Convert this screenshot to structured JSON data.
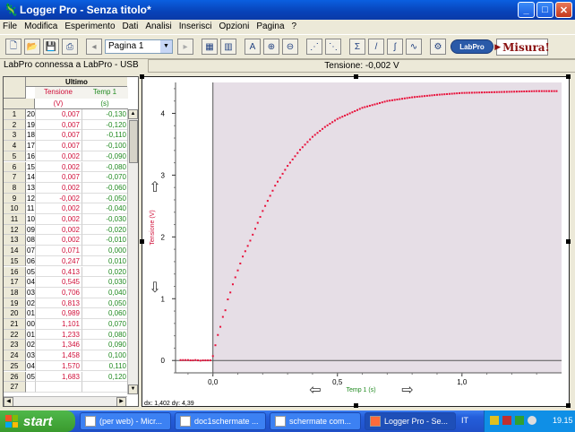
{
  "window": {
    "title": "Logger Pro - Senza titolo*"
  },
  "menu": [
    "File",
    "Modifica",
    "Esperimento",
    "Dati",
    "Analisi",
    "Inserisci",
    "Opzioni",
    "Pagina",
    "?"
  ],
  "toolbar": {
    "page_select": "Pagina 1",
    "labpro_label": "LabPro",
    "misura_label": "Misura!"
  },
  "status": {
    "connection": "LabPro connessa a LabPro - USB",
    "reading": "Tensione: -0,002 V"
  },
  "table": {
    "group_header": "Ultimo",
    "col1_header": "Tensione",
    "col1_unit": "(V)",
    "col2_header": "Temp 1",
    "col2_unit": "(s)",
    "rows": [
      [
        "1",
        "20",
        "0,007",
        "-0,130"
      ],
      [
        "2",
        "19",
        "0,007",
        "-0,120"
      ],
      [
        "3",
        "18",
        "0,007",
        "-0,110"
      ],
      [
        "4",
        "17",
        "0,007",
        "-0,100"
      ],
      [
        "5",
        "16",
        "0,002",
        "-0,090"
      ],
      [
        "6",
        "15",
        "0,002",
        "-0,080"
      ],
      [
        "7",
        "14",
        "0,007",
        "-0,070"
      ],
      [
        "8",
        "13",
        "0,002",
        "-0,060"
      ],
      [
        "9",
        "12",
        "-0,002",
        "-0,050"
      ],
      [
        "10",
        "11",
        "0,002",
        "-0,040"
      ],
      [
        "11",
        "10",
        "0,002",
        "-0,030"
      ],
      [
        "12",
        "09",
        "0,002",
        "-0,020"
      ],
      [
        "13",
        "08",
        "0,002",
        "-0,010"
      ],
      [
        "14",
        "07",
        "0,071",
        "0,000"
      ],
      [
        "15",
        "06",
        "0,247",
        "0,010"
      ],
      [
        "16",
        "05",
        "0,413",
        "0,020"
      ],
      [
        "17",
        "04",
        "0,545",
        "0,030"
      ],
      [
        "18",
        "03",
        "0,706",
        "0,040"
      ],
      [
        "19",
        "02",
        "0,813",
        "0,050"
      ],
      [
        "20",
        "01",
        "0,989",
        "0,060"
      ],
      [
        "21",
        "00",
        "1,101",
        "0,070"
      ],
      [
        "22",
        "01",
        "1,233",
        "0,080"
      ],
      [
        "23",
        "02",
        "1,346",
        "0,090"
      ],
      [
        "24",
        "03",
        "1,458",
        "0,100"
      ],
      [
        "25",
        "04",
        "1,570",
        "0,110"
      ],
      [
        "26",
        "05",
        "1,683",
        "0,120"
      ],
      [
        "27",
        "",
        "",
        ""
      ]
    ]
  },
  "graph": {
    "ylabel": "Tensione (V)",
    "xlabel": "Temp 1 (s)",
    "readout": "dx: 1,402  dy: 4,39",
    "colors": {
      "data": "#e8103a",
      "region": "#d8ccd8",
      "ylabel": "#d0103a",
      "xlabel": "#208a20"
    }
  },
  "chart_data": {
    "type": "scatter",
    "xlabel": "Temp 1 (s)",
    "ylabel": "Tensione (V)",
    "xlim": [
      -0.15,
      1.4
    ],
    "ylim": [
      -0.2,
      4.5
    ],
    "xticks": [
      0.0,
      0.5,
      1.0
    ],
    "xtick_labels": [
      "0,0",
      "0,5",
      "1,0"
    ],
    "yticks": [
      0,
      1,
      2,
      3,
      4
    ],
    "selected_region": [
      0.0,
      1.4
    ],
    "series": [
      {
        "curve": "step charge, tau ~0.25 s, plateau ~4.35 V",
        "x": [
          -0.13,
          -0.12,
          -0.11,
          -0.1,
          -0.09,
          -0.08,
          -0.07,
          -0.06,
          -0.05,
          -0.04,
          -0.03,
          -0.02,
          -0.01,
          0.0,
          0.01,
          0.02,
          0.03,
          0.04,
          0.05,
          0.06,
          0.07,
          0.08,
          0.09,
          0.1,
          0.11,
          0.12,
          0.15,
          0.2,
          0.25,
          0.3,
          0.35,
          0.4,
          0.45,
          0.5,
          0.6,
          0.7,
          0.8,
          0.9,
          1.0,
          1.1,
          1.2,
          1.3,
          1.38
        ],
        "y": [
          0.007,
          0.007,
          0.007,
          0.007,
          0.002,
          0.002,
          0.007,
          0.002,
          -0.002,
          0.002,
          0.002,
          0.002,
          0.002,
          0.071,
          0.247,
          0.413,
          0.545,
          0.706,
          0.813,
          0.989,
          1.101,
          1.233,
          1.346,
          1.458,
          1.57,
          1.683,
          1.94,
          2.42,
          2.83,
          3.15,
          3.41,
          3.62,
          3.78,
          3.91,
          4.09,
          4.2,
          4.26,
          4.3,
          4.33,
          4.34,
          4.35,
          4.36,
          4.36
        ]
      }
    ]
  },
  "taskbar": {
    "start_label": "start",
    "tasks": [
      "(per web) - Micr...",
      "doc1schermate ...",
      "schermate com...",
      "Logger Pro - Se..."
    ],
    "lang": "IT",
    "clock": "19.15"
  }
}
